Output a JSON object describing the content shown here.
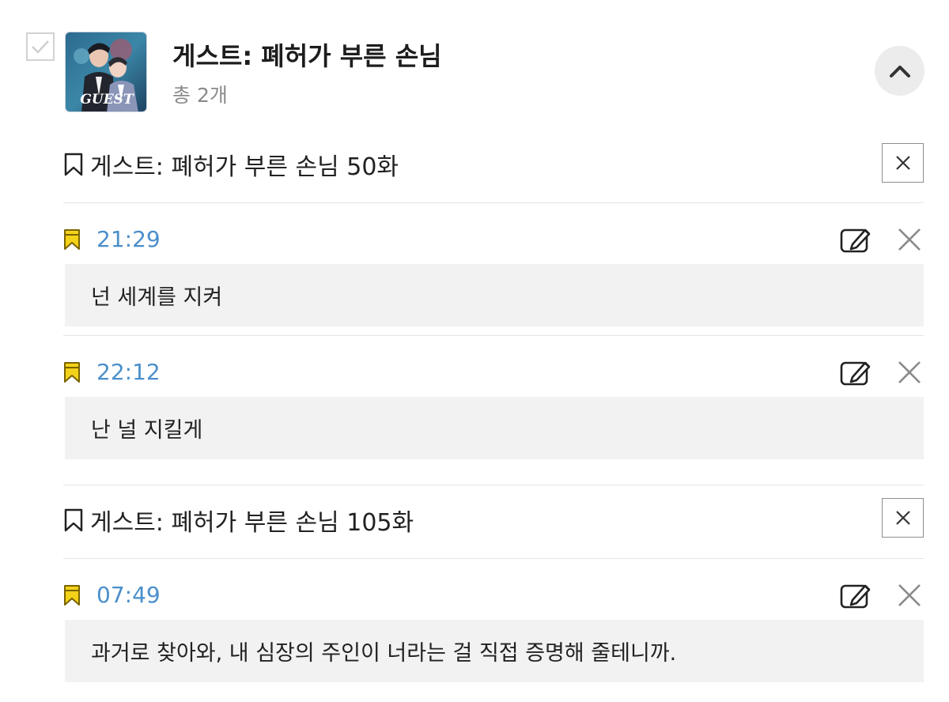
{
  "series": {
    "title": "게스트: 폐허가 부른 손님",
    "count_label": "총 2개",
    "thumbnail_text": "GUEST"
  },
  "episodes": [
    {
      "title": "게스트: 폐허가 부른 손님 50화",
      "bookmarks": [
        {
          "time": "21:29",
          "note": "넌 세계를 지켜"
        },
        {
          "time": "22:12",
          "note": "난 널 지킬게"
        }
      ]
    },
    {
      "title": "게스트: 폐허가 부른 손님 105화",
      "bookmarks": [
        {
          "time": "07:49",
          "note": "과거로 찾아와, 내 심장의 주인이 너라는 걸 직접 증명해 줄테니까."
        }
      ]
    }
  ],
  "icons": {
    "checkbox": "check-icon",
    "collapse": "chevron-up-icon",
    "episode": "bookmark-outline-icon",
    "bookmark": "bookmark-filled-icon",
    "edit": "edit-icon",
    "delete": "close-icon"
  },
  "colors": {
    "time_text": "#4a8fcb",
    "bookmark_flag": "#f3d21a",
    "note_background": "#f2f2f2"
  }
}
